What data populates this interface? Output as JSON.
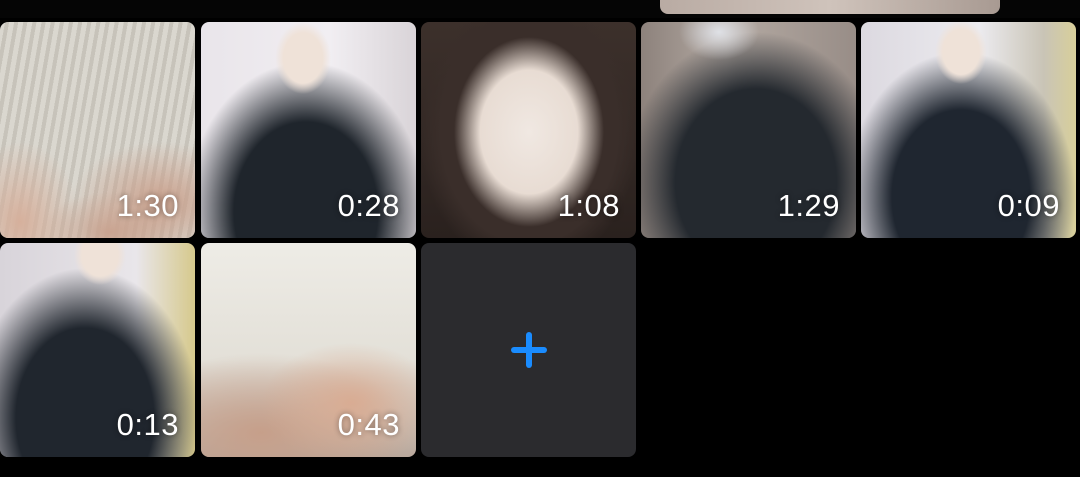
{
  "clips": [
    {
      "duration": "1:30",
      "thumbnail": "blurred-torso-thumbnail"
    },
    {
      "duration": "0:28",
      "thumbnail": "person-in-dark-shirt-thumbnail"
    },
    {
      "duration": "1:08",
      "thumbnail": "face-closeup-thumbnail"
    },
    {
      "duration": "1:29",
      "thumbnail": "person-in-dark-shirt-thumbnail"
    },
    {
      "duration": "0:09",
      "thumbnail": "person-in-dark-shirt-thumbnail"
    },
    {
      "duration": "0:13",
      "thumbnail": "person-in-dark-shirt-thumbnail"
    },
    {
      "duration": "0:43",
      "thumbnail": "hand-closeup-thumbnail"
    }
  ],
  "add_clip": {
    "icon": "plus-icon",
    "color": "#1a8cff"
  },
  "colors": {
    "background": "#000000",
    "add_tile": "#2b2b2e",
    "accent": "#1a8cff",
    "duration_text": "#ffffff"
  }
}
